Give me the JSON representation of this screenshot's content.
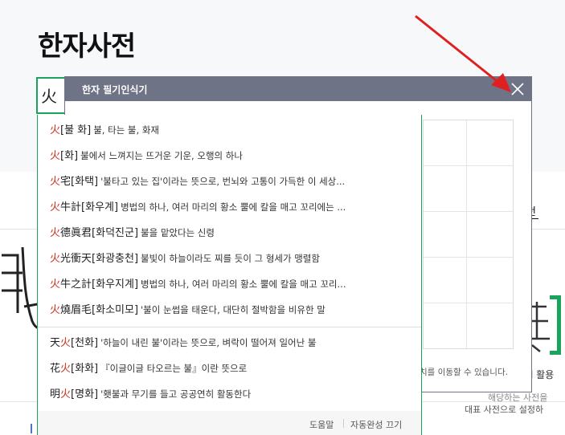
{
  "page": {
    "title": "한자사전"
  },
  "search": {
    "value": "火"
  },
  "tabs": {
    "partial": "전"
  },
  "background": {
    "line1": "l 활용",
    "line2": "해당하는 사전을",
    "line3": "대표 사전으로 설정하"
  },
  "handwriting": {
    "title": "한자 필기인식기",
    "hint": "치를 이동할 수 있습니다."
  },
  "autocomplete": {
    "items": [
      {
        "pre": "",
        "hl": "火",
        "post": "",
        "reading": "[불 화]",
        "def": "불, 타는 불, 화재"
      },
      {
        "pre": "",
        "hl": "火",
        "post": "",
        "reading": "[화]",
        "def": "불에서 느껴지는 뜨거운 기운, 오행의 하나"
      },
      {
        "pre": "",
        "hl": "火",
        "post": "宅",
        "reading": "[화택]",
        "def": "'불타고 있는 집'이라는 뜻으로, 번뇌와 고통이 가득한 이 세상..."
      },
      {
        "pre": "",
        "hl": "火",
        "post": "牛計",
        "reading": "[화우계]",
        "def": "병법의 하나, 여러 마리의 황소 뿔에 칼을 매고 꼬리에는 ..."
      },
      {
        "pre": "",
        "hl": "火",
        "post": "德眞君",
        "reading": "[화덕진군]",
        "def": "불을 맡았다는 신령"
      },
      {
        "pre": "",
        "hl": "火",
        "post": "光衝天",
        "reading": "[화광충천]",
        "def": "불빛이 하늘이라도 찌를 듯이 그 형세가 맹렬함"
      },
      {
        "pre": "",
        "hl": "火",
        "post": "牛之計",
        "reading": "[화우지계]",
        "def": "병법의 하나, 여러 마리의 황소 뿔에 칼을 매고 꼬리..."
      },
      {
        "pre": "",
        "hl": "火",
        "post": "燒眉毛",
        "reading": "[화소미모]",
        "def": "'불이 눈썹을 태운다, 대단히 절박함을 비유한 말"
      },
      {
        "pre": "天",
        "hl": "火",
        "post": "",
        "reading": "[천화]",
        "def": "'하늘이 내린 불'이라는 뜻으로, 벼락이 떨어져 일어난 불"
      },
      {
        "pre": "花",
        "hl": "火",
        "post": "",
        "reading": "[화화]",
        "def": "『이글이글 타오르는 불』이란 뜻으로"
      },
      {
        "pre": "明",
        "hl": "火",
        "post": "",
        "reading": "[명화]",
        "def": "'횃불과 무기를 들고 공공연히 활동한다"
      }
    ],
    "footer": {
      "help": "도움말",
      "toggle": "자동완성 끄기"
    }
  },
  "colors": {
    "accent": "#1aa35a",
    "highlight": "#d0341f",
    "panel_header": "#6e7386",
    "arrow": "#e02020"
  },
  "icons": [
    "close-icon",
    "arrow-pointer"
  ]
}
